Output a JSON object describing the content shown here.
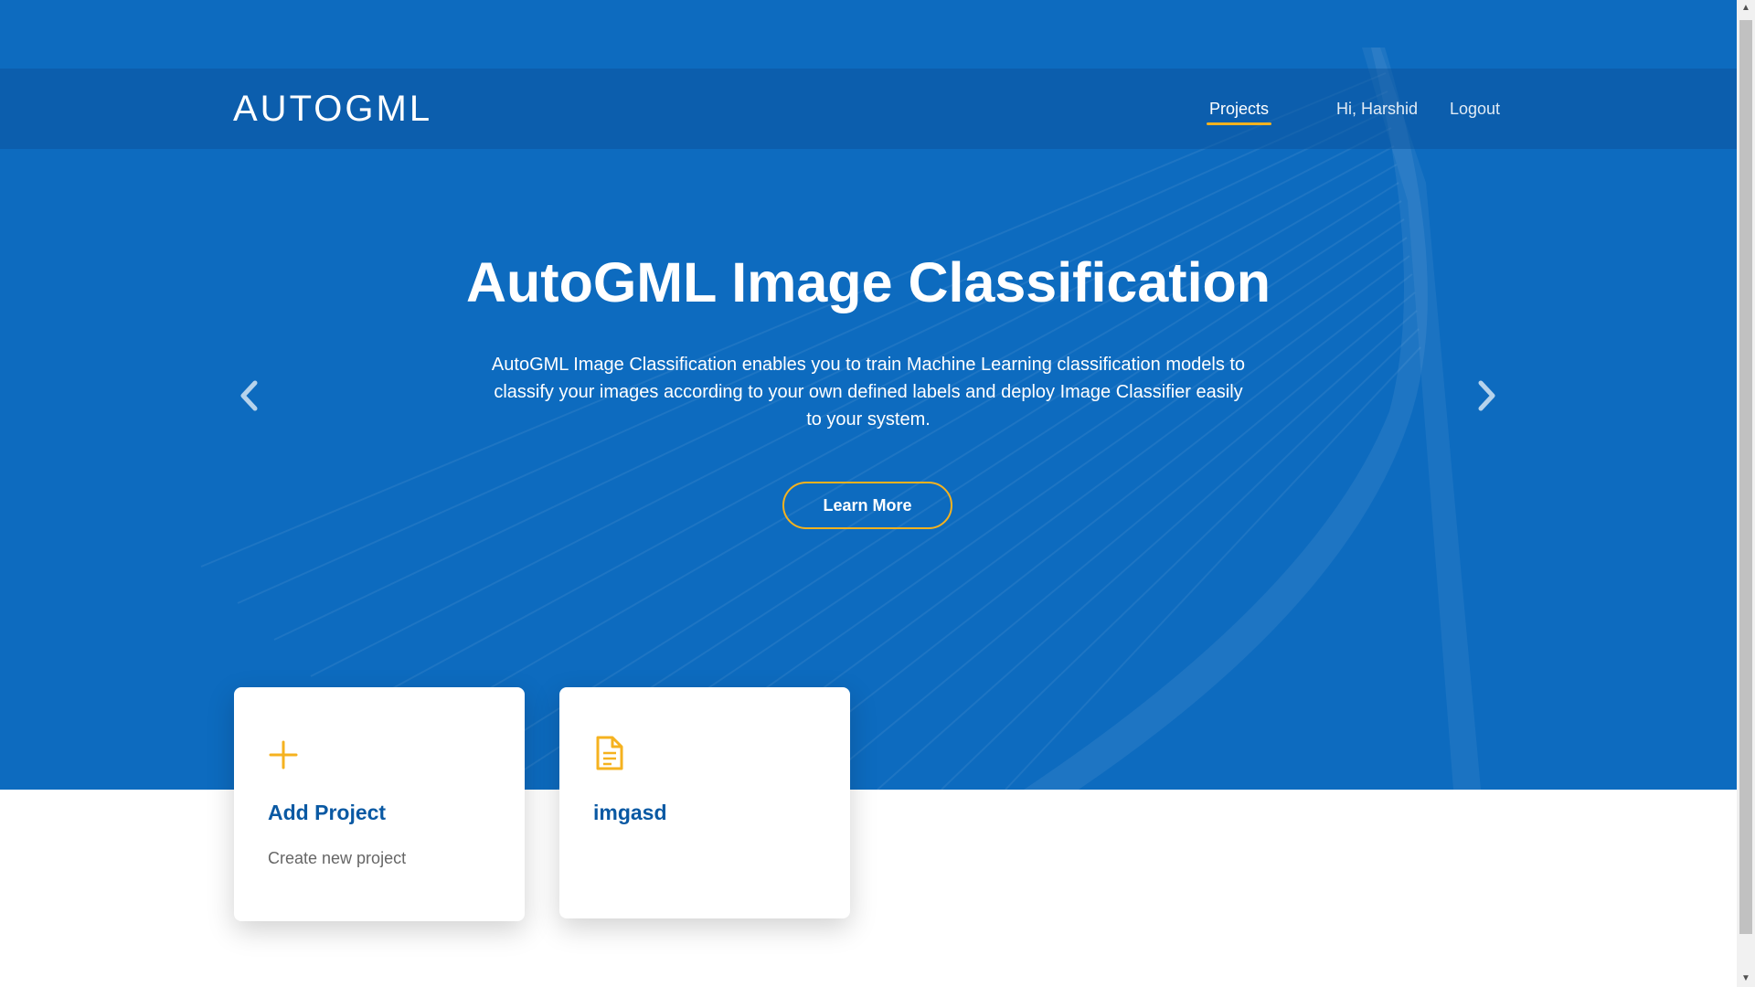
{
  "navbar": {
    "brand": "AUTOGML",
    "links": {
      "projects": "Projects",
      "user": "Hi, Harshid",
      "logout": "Logout"
    }
  },
  "hero": {
    "title": "AutoGML Image Classification",
    "description": "AutoGML Image Classification enables you to train Machine Learning classification models to classify your images according to your own defined labels and deploy Image Classifier easily to your system.",
    "button_label": "Learn More"
  },
  "cards": [
    {
      "title": "Add Project",
      "subtitle": "Create new project",
      "icon": "plus-icon"
    },
    {
      "title": "imgasd",
      "subtitle": "",
      "icon": "document-icon"
    }
  ],
  "colors": {
    "hero_blue": "#0d6bbf",
    "accent": "#f5b21f",
    "card_title": "#0a59a3"
  },
  "icons": {
    "prev": "chevron-left-icon",
    "next": "chevron-right-icon",
    "scroll_up": "▲",
    "scroll_down": "▼"
  }
}
